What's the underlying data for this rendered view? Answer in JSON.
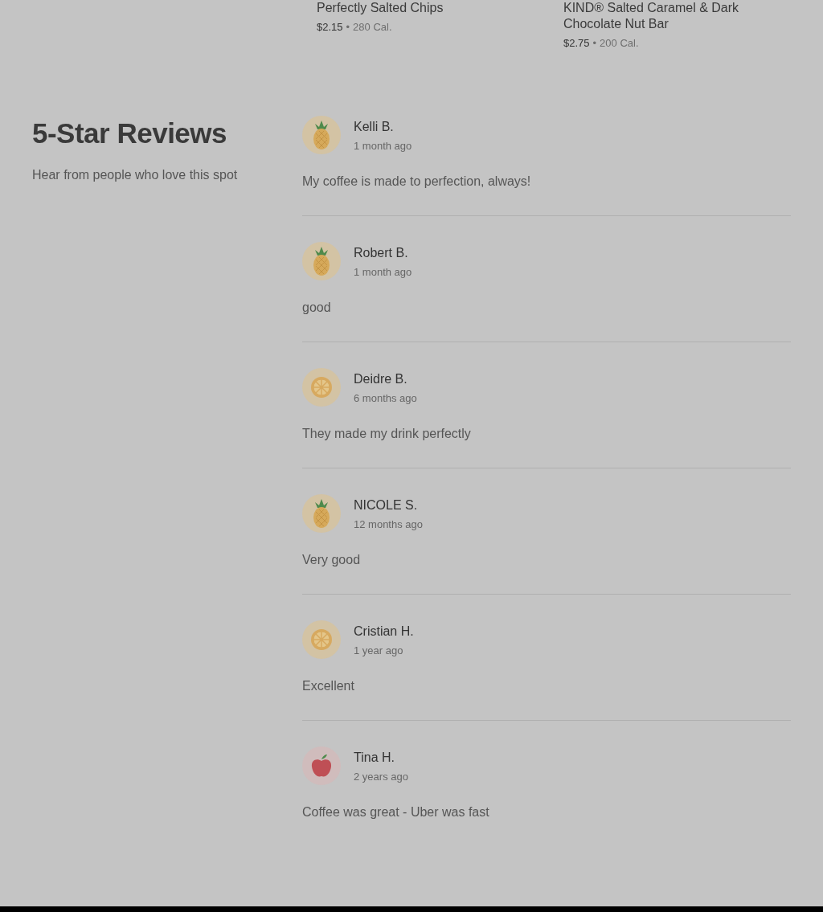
{
  "products": [
    {
      "name": "Perfectly Salted Chips",
      "price": "$2.15",
      "separator": "•",
      "calories": "280 Cal."
    },
    {
      "name": "KIND® Salted Caramel & Dark Chocolate Nut Bar",
      "price": "$2.75",
      "separator": "•",
      "calories": "200 Cal."
    }
  ],
  "reviews_section": {
    "title": "5-Star Reviews",
    "subtitle": "Hear from people who love this spot"
  },
  "reviews": [
    {
      "kind": "pineapple",
      "name": "Kelli B.",
      "time": "1 month ago",
      "text": "My coffee is made to perfection, always!"
    },
    {
      "kind": "pineapple",
      "name": "Robert B.",
      "time": "1 month ago",
      "text": "good"
    },
    {
      "kind": "citrus",
      "name": "Deidre B.",
      "time": "6 months ago",
      "text": "They made my drink perfectly"
    },
    {
      "kind": "pineapple",
      "name": "NICOLE S.",
      "time": "12 months ago",
      "text": "Very good"
    },
    {
      "kind": "citrus",
      "name": "Cristian H.",
      "time": "1 year ago",
      "text": "Excellent"
    },
    {
      "kind": "apple",
      "name": "Tina H.",
      "time": "2 years ago",
      "text": "Coffee was great - Uber was fast"
    }
  ]
}
